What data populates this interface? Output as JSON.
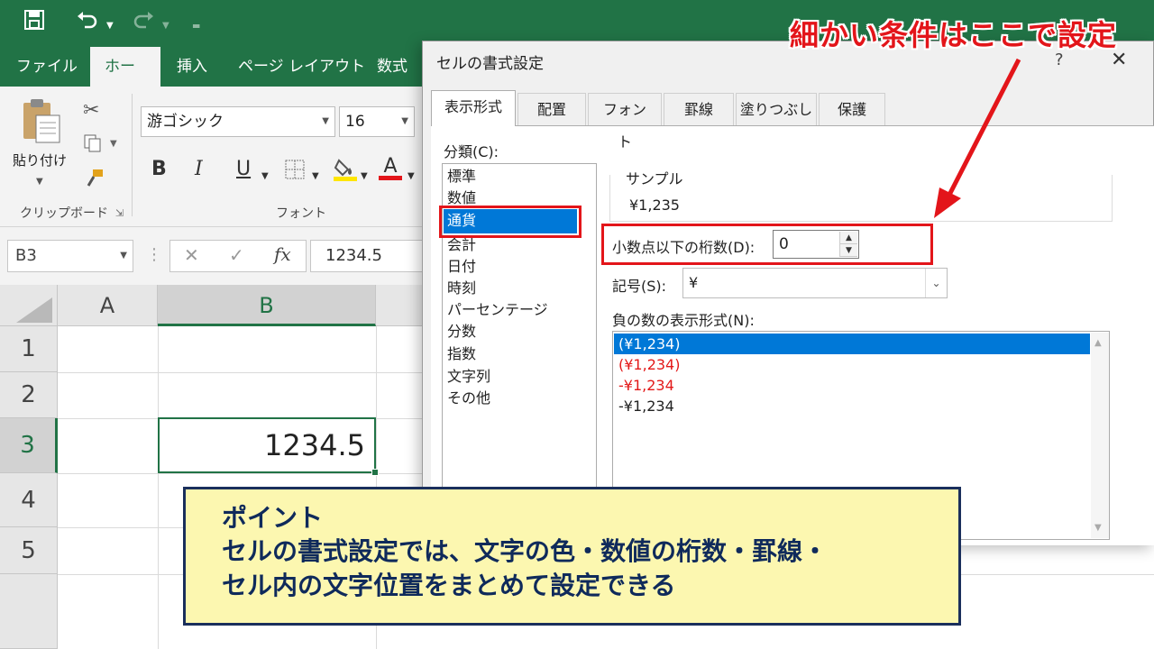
{
  "excel": {
    "qat": {
      "save_icon": "save-icon",
      "undo_icon": "undo-icon",
      "redo_icon": "redo-icon"
    },
    "tabs": [
      "ファイル",
      "ホーム",
      "挿入",
      "ページ レイアウト",
      "数式"
    ],
    "active_tab": "ホーム",
    "ribbon": {
      "paste_label": "貼り付け",
      "clipboard_group": "クリップボード",
      "font_group": "フォント",
      "font_name": "游ゴシック",
      "font_size": "16",
      "bold": "B",
      "italic": "I",
      "underline": "U",
      "font_color_letter": "A"
    },
    "namebox": "B3",
    "formula_value": "1234.5",
    "fx": "fx",
    "columns": [
      "A",
      "B"
    ],
    "rows": [
      "1",
      "2",
      "3",
      "4",
      "5"
    ],
    "selected_cell_value": "1234.5"
  },
  "dialog": {
    "title": "セルの書式設定",
    "help": "?",
    "close": "✕",
    "tabs": [
      "表示形式",
      "配置",
      "フォント",
      "罫線",
      "塗りつぶし",
      "保護"
    ],
    "category_label": "分類(C):",
    "categories": [
      "標準",
      "数値",
      "通貨",
      "会計",
      "日付",
      "時刻",
      "パーセンテージ",
      "分数",
      "指数",
      "文字列",
      "その他"
    ],
    "selected_category": "通貨",
    "sample_label": "サンプル",
    "sample_value": "¥1,235",
    "decimal_label": "小数点以下の桁数(D):",
    "decimal_value": "0",
    "symbol_label": "記号(S):",
    "symbol_value": "¥",
    "negative_label": "負の数の表示形式(N):",
    "negative_formats": [
      {
        "text": "(¥1,234)",
        "color": "#ffffff",
        "selected": true
      },
      {
        "text": "(¥1,234)",
        "color": "#e31919"
      },
      {
        "text": "-¥1,234",
        "color": "#e31919"
      },
      {
        "text": "-¥1,234",
        "color": "#222222"
      }
    ]
  },
  "annotation": {
    "headline": "細かい条件はここで設定",
    "point_title": "ポイント",
    "point_line1": "セルの書式設定では、文字の色・数値の桁数・罫線・",
    "point_line2": "セル内の文字位置をまとめて設定できる",
    "accent_color": "#e3151a"
  }
}
